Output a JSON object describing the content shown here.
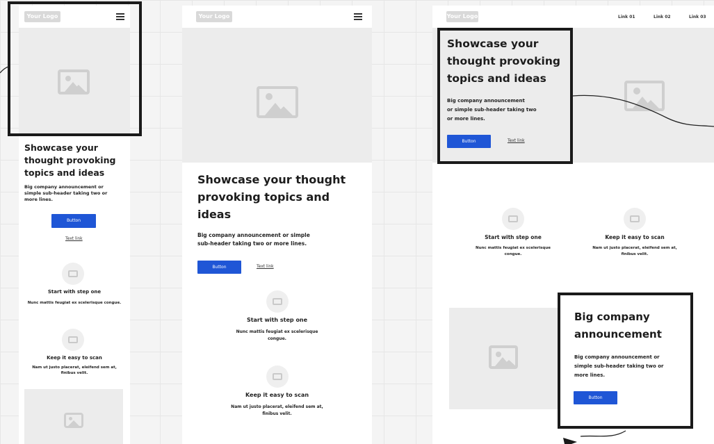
{
  "logo": "Your Logo",
  "headline": "Showcase your thought provoking topics and ideas",
  "headline_mobile": [
    "Showcase your",
    "thought provoking",
    "topics and ideas"
  ],
  "headline_tablet": [
    "Showcase your thought",
    "provoking topics and",
    "ideas"
  ],
  "subheader_mobile": [
    "Big company announcement or",
    "simple sub-header taking two or",
    "more lines."
  ],
  "subheader_tablet": [
    "Big company announcement or simple",
    "sub-header taking two or more lines."
  ],
  "subheader_desktop": [
    "Big company announcement",
    "or simple sub-header taking two",
    "or more lines."
  ],
  "button": "Button",
  "text_link": "Text link",
  "step1_title": "Start with step one",
  "step1_body_mobile": "Nunc mattis feugiat ex scelerisque congue.",
  "step1_body": [
    "Nunc mattis feugiat ex scelerisque",
    "congue."
  ],
  "step2_title": "Keep it easy to scan",
  "step2_body": [
    "Nam ut justo placerat, eleifend sem at,",
    "finibus velit."
  ],
  "nav_links": [
    "Link 01",
    "Link 02",
    "Link 03"
  ],
  "announce_title": [
    "Big company",
    "announcement"
  ],
  "announce_body": [
    "Big company announcement or",
    "simple sub-header taking two or",
    "more lines."
  ]
}
